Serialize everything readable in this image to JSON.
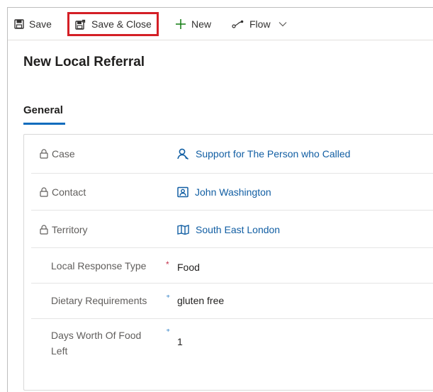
{
  "toolbar": {
    "save_label": "Save",
    "save_close_label": "Save & Close",
    "new_label": "New",
    "flow_label": "Flow"
  },
  "page": {
    "title": "New Local Referral"
  },
  "tabs": [
    {
      "label": "General",
      "active": true
    }
  ],
  "form": {
    "fields": [
      {
        "label": "Case",
        "value": "Support for The Person who Called",
        "locked": true,
        "icon": "user-search-icon"
      },
      {
        "label": "Contact",
        "value": "John Washington",
        "locked": true,
        "icon": "contact-card-icon"
      },
      {
        "label": "Territory",
        "value": "South East London",
        "locked": true,
        "icon": "map-icon"
      },
      {
        "label": "Local Response Type",
        "value": "Food",
        "required": "*"
      },
      {
        "label": "Dietary Requirements",
        "value": "gluten free",
        "required": "⁺"
      },
      {
        "label_line1": "Days Worth Of Food",
        "label_line2": "Left",
        "value": "1",
        "required": "⁺"
      }
    ]
  },
  "colors": {
    "accent": "#0f6cbd",
    "highlight_box": "#d41f26",
    "link": "#115ea3",
    "required_red": "#c4314b"
  }
}
